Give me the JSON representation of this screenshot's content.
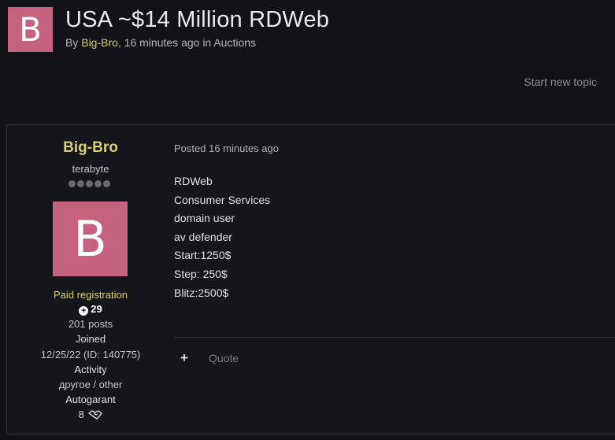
{
  "topic": {
    "avatar_letter": "B",
    "title": "USA ~$14 Million RDWeb",
    "meta_prefix": "By ",
    "author": "Big-Bro",
    "meta_middle": ", 16 minutes ago in ",
    "forum": "Auctions"
  },
  "actions": {
    "start_new_topic": "Start new topic"
  },
  "author_panel": {
    "name": "Big-Bro",
    "title": "terabyte",
    "rank_pips": 5,
    "avatar_letter": "B",
    "group": "Paid registration",
    "reputation": "29",
    "posts": "201 posts",
    "joined_label": "Joined",
    "joined_value": "12/25/22 (ID: 140775)",
    "activity_label": "Activity",
    "activity_value": "другое / other",
    "autogarant_label": "Autogarant",
    "autogarant_value": "8"
  },
  "post": {
    "posted": "Posted 16 minutes ago",
    "lines": [
      "RDWeb",
      "Consumer Services",
      "domain user",
      "av defender",
      "Start:1250$",
      "Step: 250$",
      "Blitz:2500$"
    ],
    "plus_icon": "+",
    "quote_label": "Quote"
  },
  "colors": {
    "background": "#121318",
    "accent_username": "#d8cf6d",
    "avatar": "#c5637f"
  }
}
